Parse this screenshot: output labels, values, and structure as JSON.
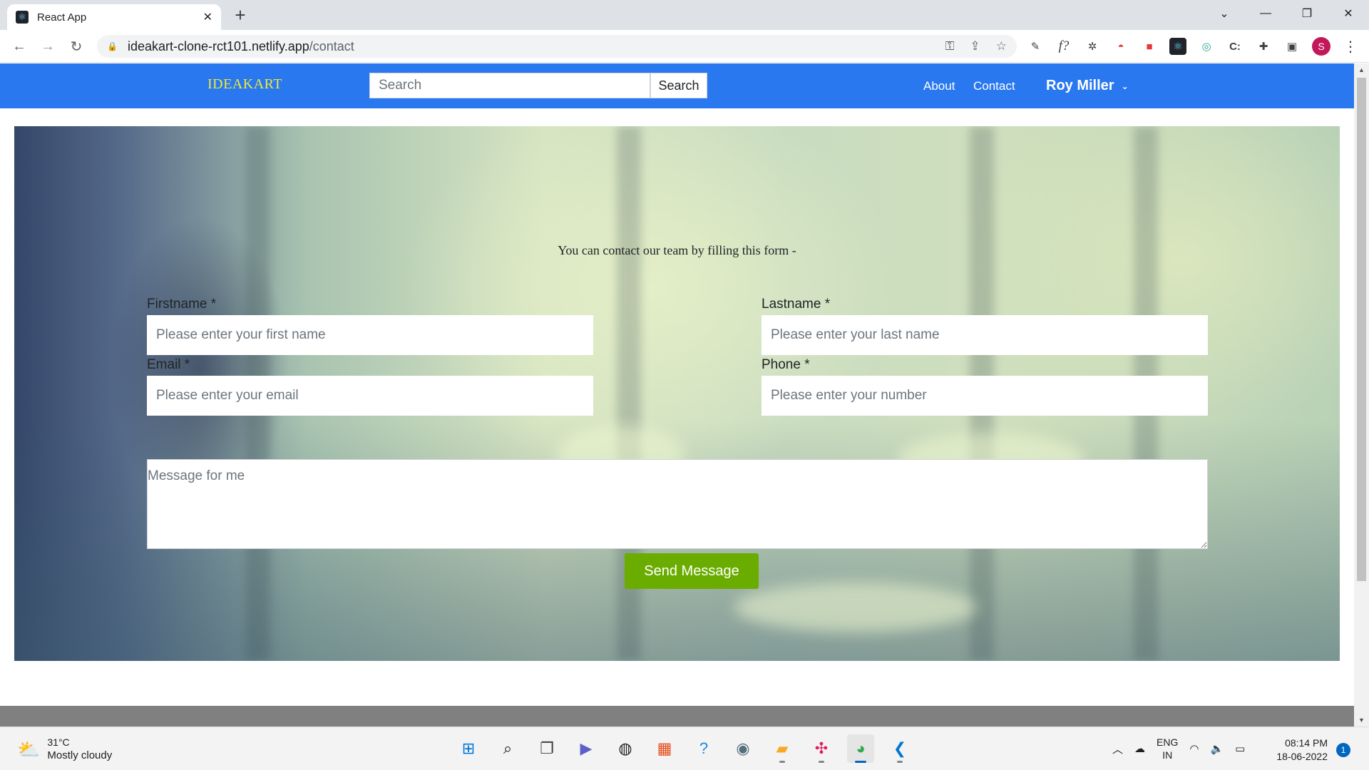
{
  "browser": {
    "tab_title": "React App",
    "tab_close": "✕",
    "new_tab": "+",
    "window_controls": {
      "dropdown": "⌄",
      "minimize": "—",
      "restore": "❐",
      "close": "✕"
    },
    "url_host": "ideakart-clone-rct101.netlify.app",
    "url_path": "/contact",
    "profile_initial": "S",
    "extensions": [
      "eyedropper-icon",
      "font-finder-icon",
      "bug-icon",
      "pokeball-icon",
      "car-icon",
      "react-devtools-icon",
      "circle-ext-icon",
      "css-ext-icon",
      "puzzle-icon",
      "side-panel-icon"
    ]
  },
  "site_nav": {
    "brand": "IDEAKART",
    "search_placeholder": "Search",
    "search_button": "Search",
    "about": "About",
    "contact": "Contact",
    "user_name": "Roy Miller",
    "user_caret": "⌄"
  },
  "contact_form": {
    "intro": "You can contact our team by filling this form -",
    "firstname_label": "Firstname *",
    "firstname_placeholder": "Please enter your first name",
    "lastname_label": "Lastname *",
    "lastname_placeholder": "Please enter your last name",
    "email_label": "Email *",
    "email_placeholder": "Please enter your email",
    "phone_label": "Phone *",
    "phone_placeholder": "Please enter your number",
    "message_placeholder": "Message for me",
    "send_button": "Send Message"
  },
  "taskbar": {
    "weather_temp": "31°C",
    "weather_condition": "Mostly cloudy",
    "apps": [
      "windows-start-icon",
      "search-icon",
      "task-view-icon",
      "teams-chat-icon",
      "browser-app-icon",
      "store-icon",
      "help-icon",
      "camera-icon",
      "file-explorer-icon",
      "slack-icon",
      "chrome-icon",
      "vscode-icon"
    ],
    "lang_line1": "ENG",
    "lang_line2": "IN",
    "time": "08:14 PM",
    "date": "18-06-2022",
    "notification_count": "1"
  },
  "colors": {
    "nav_bg": "#2a78ef",
    "brand_color": "#f0ea3b",
    "send_button_bg": "#6aad00"
  }
}
